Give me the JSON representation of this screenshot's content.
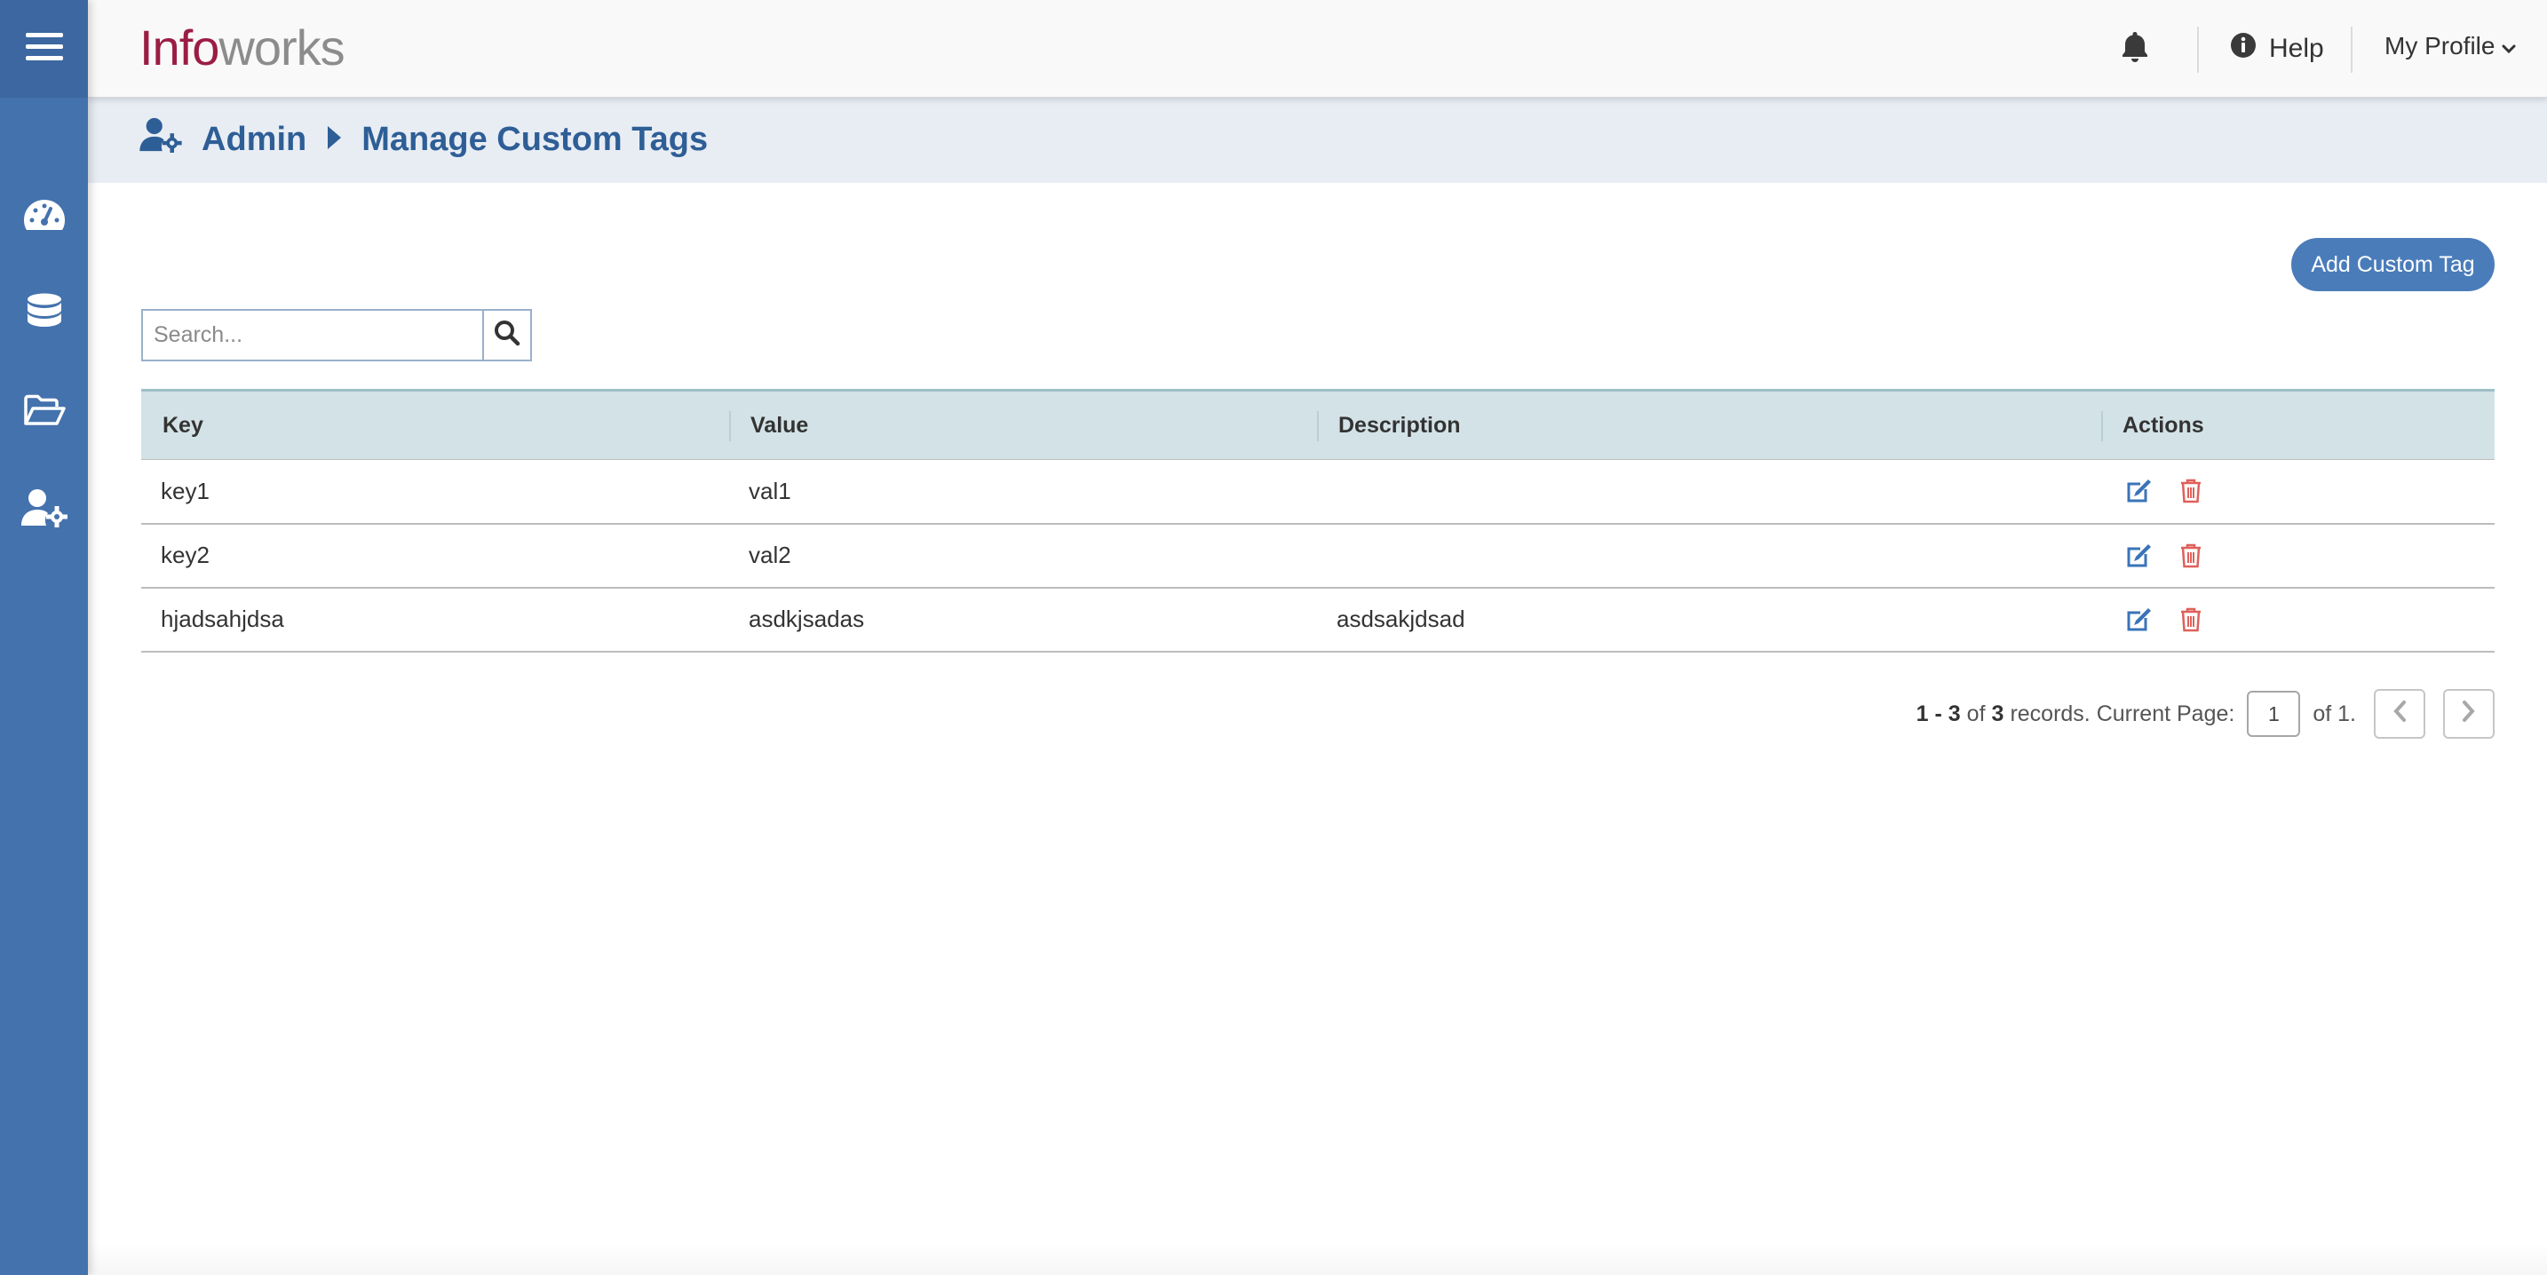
{
  "app": {
    "logo_part1": "Info",
    "logo_part2": "works",
    "help_label": "Help",
    "profile_label": "My Profile",
    "colors": {
      "sidebar": "#4472ad",
      "accent": "#4a7cba",
      "brand": "#9b1d44",
      "delete": "#e0605a"
    }
  },
  "sidebar": {
    "items": [
      {
        "icon": "dashboard-icon"
      },
      {
        "icon": "database-icon"
      },
      {
        "icon": "folder-open-icon"
      },
      {
        "icon": "user-settings-icon"
      }
    ]
  },
  "breadcrumb": {
    "root": "Admin",
    "current": "Manage Custom Tags"
  },
  "toolbar": {
    "add_label": "Add Custom Tag",
    "search_placeholder": "Search..."
  },
  "table": {
    "headers": [
      "Key",
      "Value",
      "Description",
      "Actions"
    ],
    "rows": [
      {
        "key": "key1",
        "value": "val1",
        "description": ""
      },
      {
        "key": "key2",
        "value": "val2",
        "description": ""
      },
      {
        "key": "hjadsahjdsa",
        "value": "asdkjsadas",
        "description": "asdsakjdsad"
      }
    ]
  },
  "pagination": {
    "range": "1 - 3",
    "of_word": "of",
    "total": "3",
    "records_text": "records. Current Page:",
    "current_page": "1",
    "of_pages": "of 1."
  }
}
